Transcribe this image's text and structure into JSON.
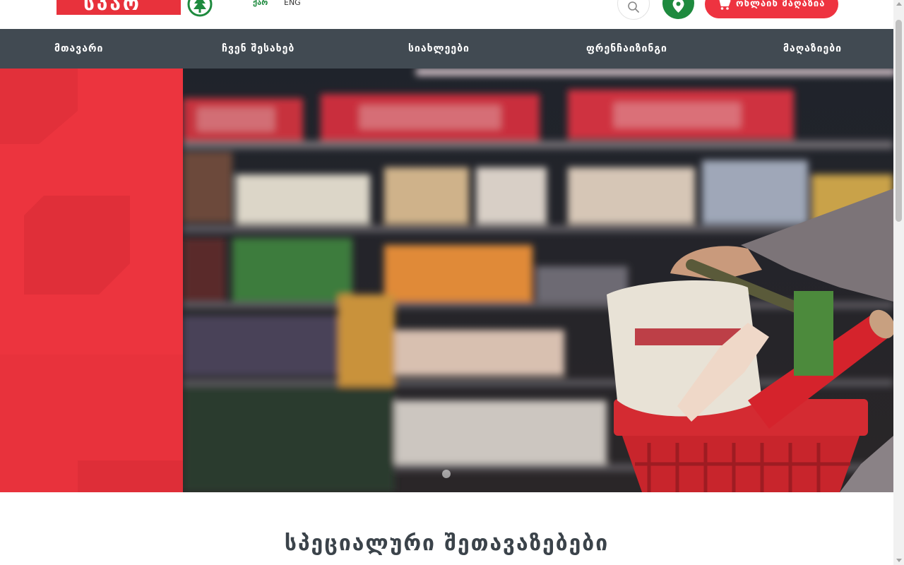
{
  "brand": {
    "logo_text": "სპარ",
    "accent_color": "#ee3340",
    "green_color": "#1e8a3e",
    "nav_color": "#414a52"
  },
  "header": {
    "languages": [
      {
        "label": "ქარ",
        "active": true
      },
      {
        "label": "ENG",
        "active": false
      }
    ],
    "search_icon": "search-icon",
    "location_icon": "map-pin-icon",
    "shop_button": {
      "icon": "cart-icon",
      "label": "ონლაინ მაღაზია"
    }
  },
  "nav": {
    "items": [
      {
        "label": "მთავარი"
      },
      {
        "label": "ჩვენ შესახებ"
      },
      {
        "label": "სიახლეები"
      },
      {
        "label": "ფრენჩაიზინგი"
      },
      {
        "label": "მაღაზიები"
      }
    ]
  },
  "hero": {
    "slides_count": 1,
    "active_slide": 1
  },
  "section": {
    "title": "სპეციალური შეთავაზებები"
  }
}
